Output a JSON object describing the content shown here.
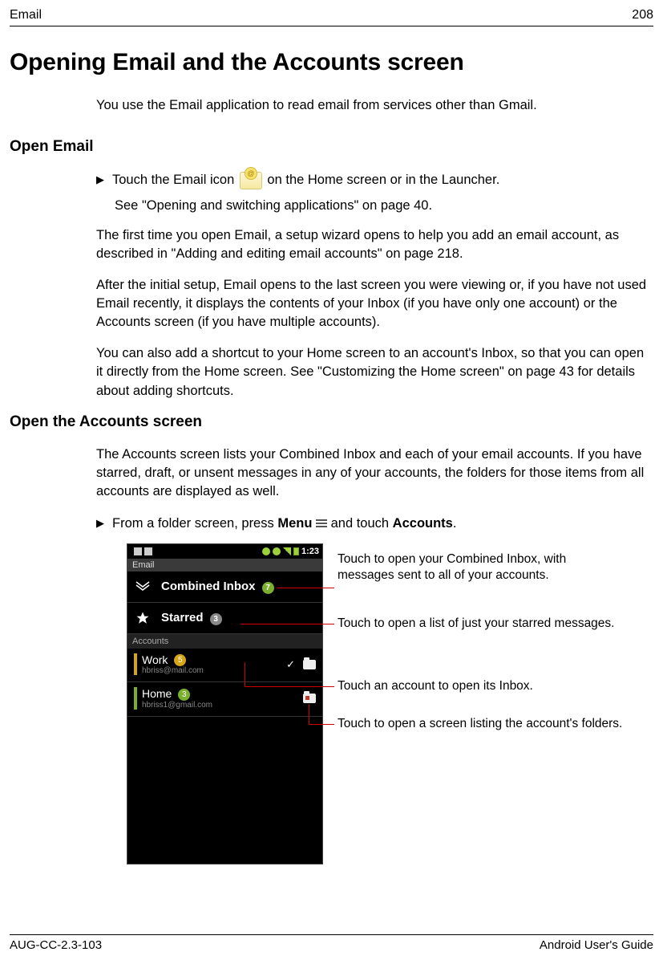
{
  "header": {
    "section": "Email",
    "page": "208"
  },
  "title": "Opening Email and the Accounts screen",
  "intro": "You use the Email application to read email from services other than Gmail.",
  "h2a": "Open Email",
  "bullet1_pre": "Touch the Email icon ",
  "bullet1_post": " on the Home screen or in the Launcher.",
  "subline1": "See \"Opening and switching applications\" on page 40.",
  "para1": "The first time you open Email, a setup wizard opens to help you add an email account, as described in \"Adding and editing email accounts\" on page 218.",
  "para2": "After the initial setup, Email opens to the last screen you were viewing or, if you have not used Email recently, it displays the contents of your Inbox (if you have only one account) or the Accounts screen (if you have multiple accounts).",
  "para3": "You can also add a shortcut to your Home screen to an account's Inbox, so that you can open it directly from the Home screen. See \"Customizing the Home screen\" on page 43 for details about adding shortcuts.",
  "h2b": "Open the Accounts screen",
  "para4": "The Accounts screen lists your Combined Inbox and each of your email accounts. If you have starred, draft, or unsent messages in any of your accounts, the folders for those items from all accounts are displayed as well.",
  "bullet2_pre": "From a folder screen, press ",
  "bullet2_menu": "Menu",
  "bullet2_mid": " and touch ",
  "bullet2_accounts": "Accounts",
  "bullet2_post": ".",
  "phone": {
    "time": "1:23",
    "app_title": "Email",
    "combined": "Combined Inbox",
    "combined_count": "7",
    "starred": "Starred",
    "starred_count": "3",
    "accounts_hdr": "Accounts",
    "work": {
      "name": "Work",
      "email": "hbriss@mail.com",
      "count": "5"
    },
    "home": {
      "name": "Home",
      "email": "hbriss1@gmail.com",
      "count": "3"
    }
  },
  "callouts": {
    "c1": "Touch to open your Combined Inbox, with messages sent to all of your accounts.",
    "c2": "Touch to open a list of just your starred messages.",
    "c3": "Touch an account to open its Inbox.",
    "c4": "Touch to open a screen listing the account's folders."
  },
  "footer": {
    "left": "AUG-CC-2.3-103",
    "right": "Android User's Guide"
  }
}
